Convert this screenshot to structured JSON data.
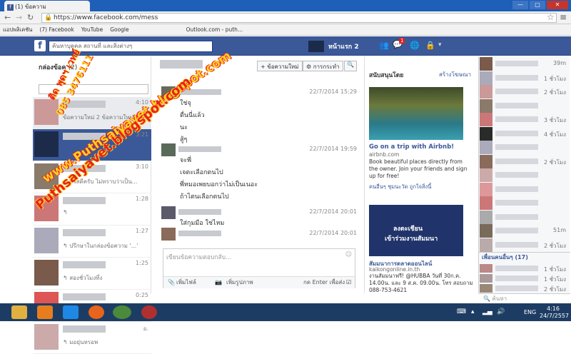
{
  "browser": {
    "tab_title": "(1) ข้อความ",
    "url": "https://www.facebook.com/mess",
    "bookmarks": [
      "แอปพลิเคชัน",
      "(7) Facebook",
      "YouTube",
      "Google",
      "Outlook.com - puth..."
    ],
    "win_btns": [
      "—",
      "▢",
      "✕"
    ]
  },
  "fb": {
    "search_placeholder": "ค้นหาบุคคล สถานที่ และสิ่งต่างๆ",
    "home": "หน้าแรก 2",
    "notif_count": "1"
  },
  "left": {
    "header": "กล่องข้อค",
    "header_count": "(2)",
    "search_placeholder": "",
    "threads": [
      {
        "time": "4:10",
        "preview": "ข้อความใหม่ 2 ข้อความใหม่",
        "selected": true
      },
      {
        "time": "3:21",
        "preview": ""
      },
      {
        "time": "3:10",
        "preview": "↰ สวัสดีครับ ไม่ทราบว่าเป็น..."
      },
      {
        "time": "1:28",
        "preview": "↰"
      },
      {
        "time": "1:27",
        "preview": "↰ ปรึกษาในกล่องข้อความ '...'"
      },
      {
        "time": "1:25",
        "preview": "↰ สองชั่วโมงที่ง"
      },
      {
        "time": "0:25",
        "preview": "↰ 5555"
      },
      {
        "time": "อ.",
        "preview": "↰ มอยุ่นหรอพ"
      }
    ]
  },
  "mid": {
    "btn_new": "+ ข้อความใหม่",
    "btn_actions": "⚙ การกระทำ",
    "btn_search": "🔍",
    "messages": [
      {
        "stamp": "22/7/2014 15:29",
        "lines": [
          "ใช่จุ",
          "ตื่นนี่แล้ว",
          "นะ",
          "สู้ๆ"
        ]
      },
      {
        "stamp": "22/7/2014 19:59",
        "lines": [
          "จะพี่",
          "เจตะเลือกตนไป",
          "พี่หมอเพยบอกว่าไม่เป็นเนอะ",
          "ถ้าไตนเลือกตนไป"
        ]
      },
      {
        "stamp": "22/7/2014 20:01",
        "lines": [
          "ใส่กุมมือ ใช่ไหม"
        ]
      },
      {
        "stamp": "22/7/2014 20:01",
        "lines": []
      }
    ],
    "reply_placeholder": "เขียนข้อความตอบกลับ...",
    "add_file": "เพิ่มไฟล์",
    "add_photo": "เพิ่มรูปภาพ",
    "enter_hint": "กด Enter เพื่อส่ง"
  },
  "ads": {
    "header": "สนับสนุนโดย",
    "create": "สร้างโฆษณา",
    "ad1": {
      "title": "Go on a trip with Airbnb!",
      "domain": "airbnb.com",
      "body": "Book beautiful places directly from the owner. Join your friends and sign up for free!",
      "likes": "คนอื่นๆ ชุมนะวัด ถูกใจสิ่งนี้"
    },
    "ad2": {
      "banner1": "ลงตะเชียน",
      "banner2": "เข้าร่วมงานสัมมนา",
      "title": "สัมมนาการตลาดออนไลน์",
      "domain": "kaikongonline.in.th",
      "body": "งานสัมมนาฟรี! @HUBBA วันที่ 30ก.ค. 14.00น. และ 9 ส.ค. 09.00น. โทร สอบถาม 088-753-4621"
    }
  },
  "chat": {
    "statuses": [
      "39m",
      "1 ชั่วโมง",
      "2 ชั่วโมง",
      "",
      "3 ชั่วโมง",
      "4 ชั่วโมง",
      "",
      "2 ชั่วโมง",
      "",
      "",
      "",
      "",
      "51m",
      "2 ชั่วโมง"
    ],
    "more": "เพื่อนคนอื่นๆ (17)",
    "more_statuses": [
      "1 ชั่วโมง",
      "1 ชั่วโมง",
      "2 ชั่วโมง"
    ],
    "search_placeholder": "ค้นหา"
  },
  "taskbar": {
    "lang": "ENG",
    "time": "4:16",
    "date": "24/7/2557"
  },
  "overlay": {
    "line1": "ติด พุดฯ เวทย์",
    "line2": "085 3476111",
    "line3": "www.Puthsaiyavet.blogspot.com",
    "line4": "Puthsaiyavet.blogspot.com"
  },
  "colors": {
    "fb_blue": "#3b5998",
    "chrome_blue": "#1e5fb8",
    "overlay_red": "#e8201c",
    "overlay_yellow": "#ffd21f"
  }
}
